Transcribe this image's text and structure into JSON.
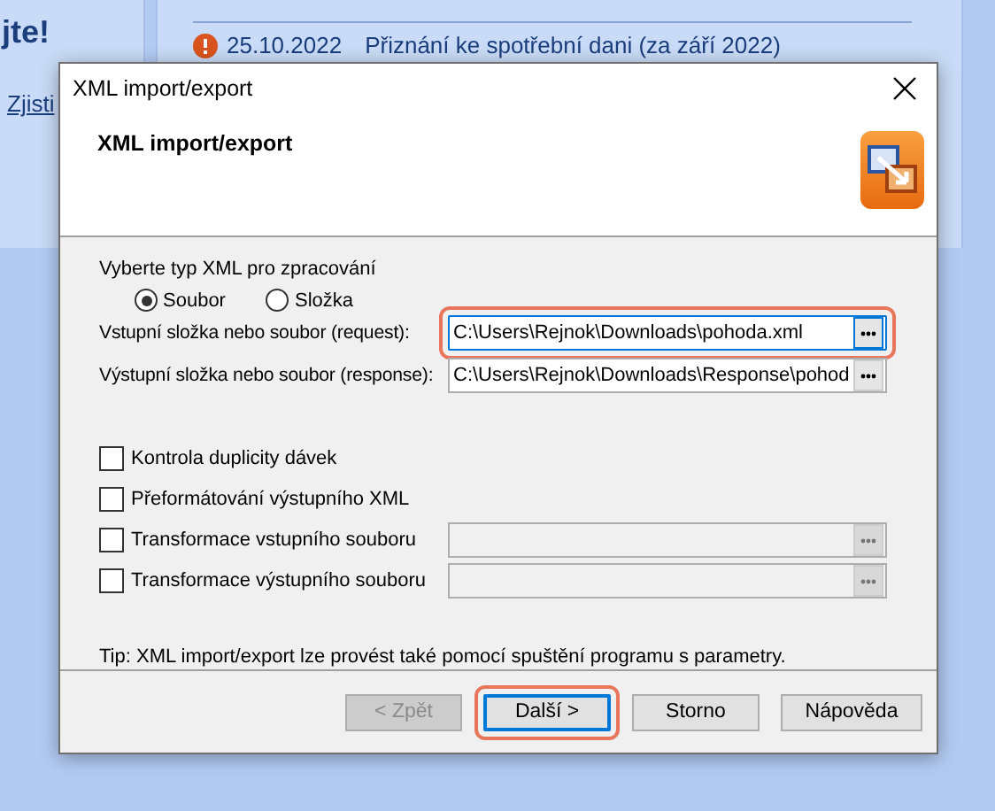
{
  "background": {
    "greeting": "jte!",
    "link": "Zjisti",
    "notice": {
      "date": "25.10.2022",
      "text": "Přiznání ke spotřební dani (za září 2022)"
    }
  },
  "dialog": {
    "title": "XML import/export",
    "heading": "XML import/export",
    "type_label": "Vyberte typ XML pro zpracování",
    "types": [
      {
        "label": "Soubor",
        "selected": true
      },
      {
        "label": "Složka",
        "selected": false
      }
    ],
    "paths": [
      {
        "label": "Vstupní složka nebo soubor (request):",
        "value": "C:\\Users\\Rejnok\\Downloads\\pohoda.xml",
        "highlighted": true,
        "focused": true
      },
      {
        "label": "Výstupní složka nebo soubor (response):",
        "value": "C:\\Users\\Rejnok\\Downloads\\Response\\pohod",
        "highlighted": false,
        "focused": false
      }
    ],
    "options": [
      {
        "kind": "check",
        "label": "Kontrola duplicity dávek",
        "checked": false
      },
      {
        "kind": "check",
        "label": "Přeformátování výstupního XML",
        "checked": false
      },
      {
        "kind": "file",
        "label": "Transformace vstupního souboru",
        "checked": false,
        "disabled": true
      },
      {
        "kind": "file",
        "label": "Transformace výstupního souboru",
        "checked": false,
        "disabled": true
      }
    ],
    "tip": "Tip: XML import/export lze provést také pomocí spuštění programu s parametry.",
    "buttons": [
      {
        "label": "< Zpět",
        "disabled": true,
        "default": false,
        "highlighted": false
      },
      {
        "label": "Další >",
        "disabled": false,
        "default": true,
        "highlighted": true
      },
      {
        "label": "Storno",
        "disabled": false,
        "default": false,
        "highlighted": false
      },
      {
        "label": "Nápověda",
        "disabled": false,
        "default": false,
        "highlighted": false
      }
    ]
  }
}
